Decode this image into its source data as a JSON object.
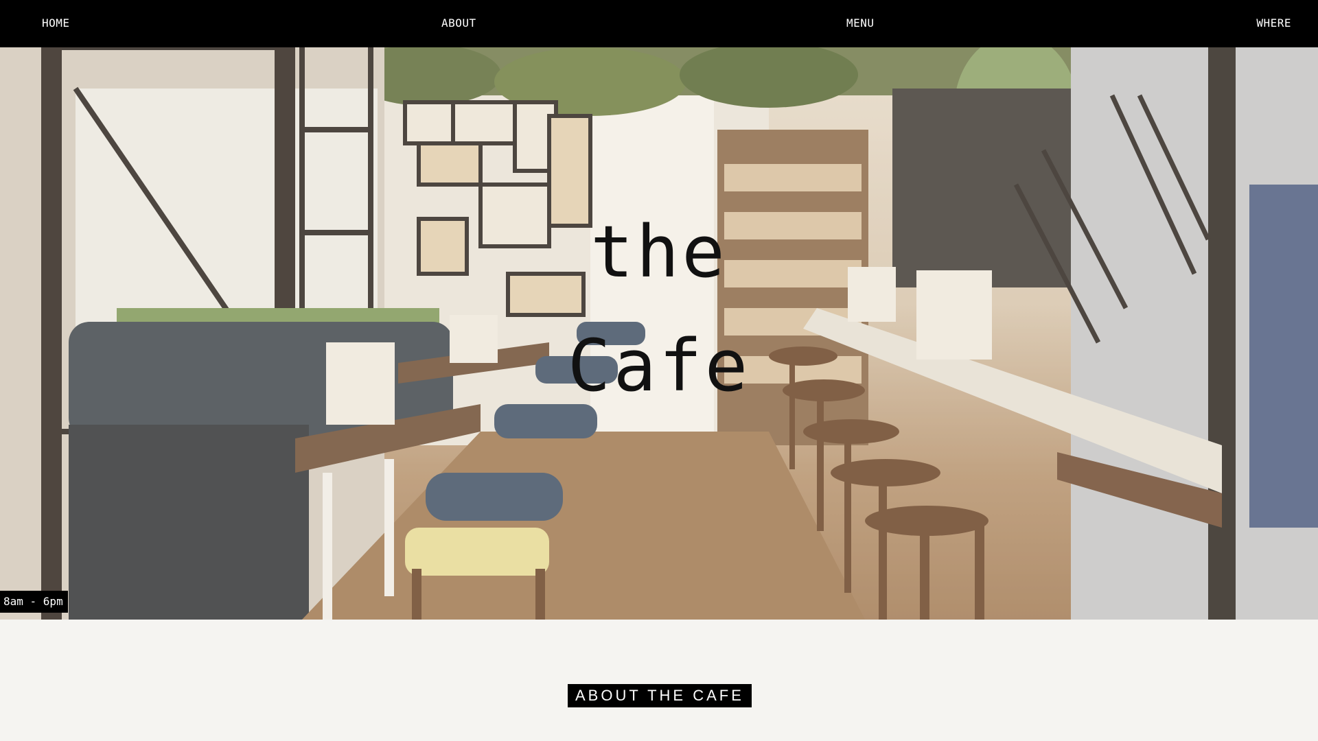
{
  "nav": {
    "home": "HOME",
    "about": "ABOUT",
    "menu": "MENU",
    "where": "WHERE"
  },
  "hero": {
    "title_line1": "the",
    "title_line2": "Cafe",
    "hours": "8am - 6pm",
    "image": "cafe-interior-photo"
  },
  "about": {
    "heading": "ABOUT THE CAFE"
  },
  "colors": {
    "nav_bg": "#000000",
    "nav_text": "#ffffff",
    "page_bg": "#f5f4f1",
    "title_text": "#111111"
  }
}
